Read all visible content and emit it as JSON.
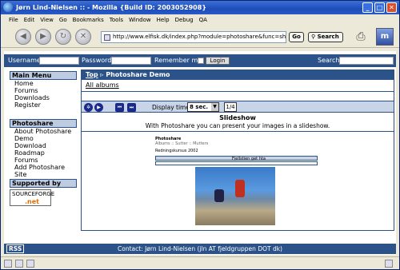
{
  "window": {
    "title": "Jørn Lind-Nielsen :: - Mozilla {Build ID: 2003052908}"
  },
  "menu": [
    "File",
    "Edit",
    "View",
    "Go",
    "Bookmarks",
    "Tools",
    "Window",
    "Help",
    "Debug",
    "QA"
  ],
  "toolbar": {
    "url": "http://www.elfisk.dk/index.php?module=photoshare&func=showimage",
    "go": "Go",
    "search": "Search"
  },
  "login": {
    "username": "Username:",
    "password": "Password:",
    "remember": "Remember me",
    "button": "Login",
    "search": "Search"
  },
  "sidebar": {
    "main_menu": {
      "title": "Main Menu",
      "items": [
        "Home",
        "Forums",
        "Downloads",
        "Register"
      ]
    },
    "photoshare": {
      "title": "Photoshare",
      "items": [
        "About Photoshare",
        "Demo",
        "Download",
        "Roadmap",
        "Forums",
        "Add Photoshare Site"
      ]
    },
    "supported": {
      "title": "Supported by",
      "logo_text": "SOURCEFORGE",
      "logo_net": ".net"
    }
  },
  "main": {
    "breadcrumb": {
      "top": "Top",
      "sep": "▹",
      "current": "Photoshare Demo"
    },
    "all_albums": "All albums",
    "display_time_label": "Display time:",
    "display_time": "8 sec.",
    "counter": "1/4",
    "slideshow_title": "Slideshow",
    "slideshow_desc": "With Photoshare you can present your images in a slideshow.",
    "screenshot": {
      "title": "Photoshare",
      "nav": "Albums :: Sutter :: Mutters",
      "album": "Redningskursus 2002",
      "bar_title": "Fjellstien get hta"
    }
  },
  "footer": {
    "rss": "RSS",
    "contact": "Contact: Jørn Lind-Nielsen (jln AT fjeldgruppen DOT dk)"
  }
}
